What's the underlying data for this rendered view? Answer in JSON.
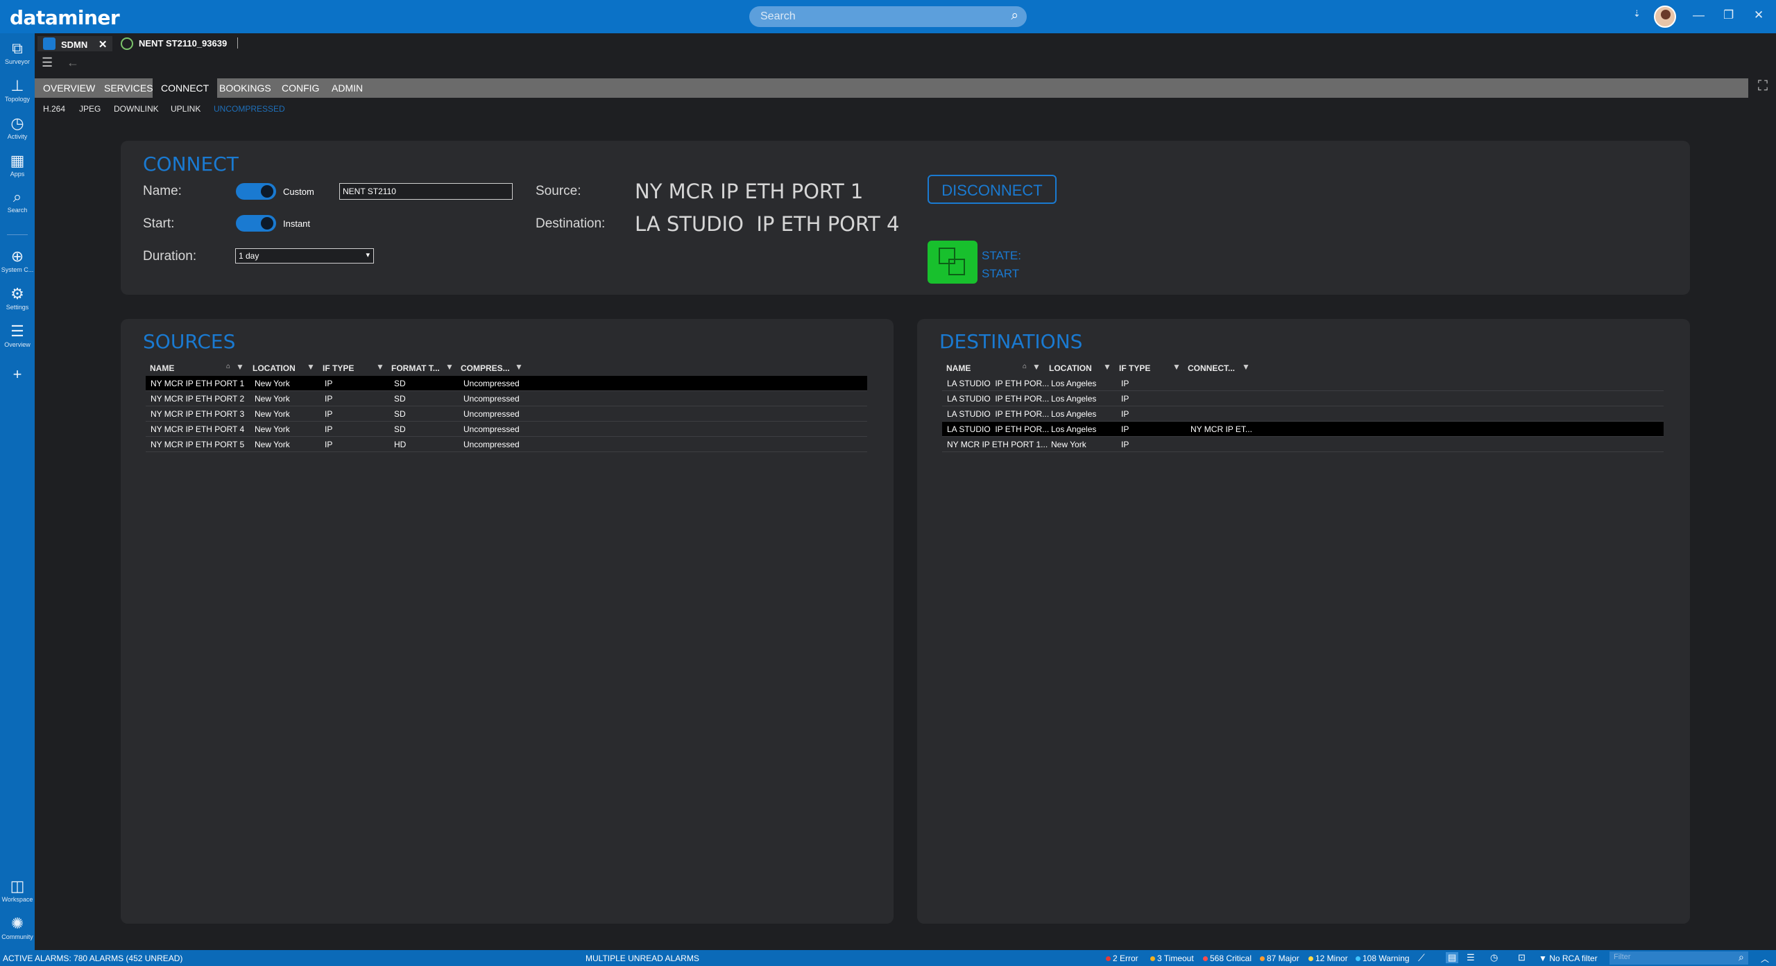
{
  "app": {
    "logo": "dataminer",
    "search_placeholder": "Search"
  },
  "colors": {
    "accent": "#1a7ad1",
    "topbar": "#0b72c7",
    "state_ok": "#18c02d"
  },
  "window": {
    "minimize": "—",
    "restore": "❐",
    "close": "✕"
  },
  "sidebar": {
    "top": [
      {
        "label": "Surveyor",
        "icon": "surveyor-icon"
      },
      {
        "label": "Topology",
        "icon": "topology-icon"
      },
      {
        "label": "Activity",
        "icon": "activity-icon"
      },
      {
        "label": "Apps",
        "icon": "apps-icon"
      },
      {
        "label": "Search",
        "icon": "search-icon"
      },
      {
        "label": "System C...",
        "icon": "globe-icon"
      },
      {
        "label": "Settings",
        "icon": "gear-icon"
      },
      {
        "label": "Overview",
        "icon": "list-icon"
      }
    ],
    "bottom": [
      {
        "label": "Workspace",
        "icon": "workspace-icon"
      },
      {
        "label": "Community",
        "icon": "community-icon"
      }
    ]
  },
  "tabs": [
    {
      "label": "SDMN",
      "closable": true
    },
    {
      "label": "NENT ST2110_93639",
      "closable": false
    }
  ],
  "menu": [
    "OVERVIEW",
    "SERVICES",
    "CONNECT",
    "BOOKINGS",
    "CONFIG",
    "ADMIN"
  ],
  "menu_active": "CONNECT",
  "submenu": [
    "H.264",
    "JPEG",
    "DOWNLINK",
    "UPLINK",
    "UNCOMPRESSED"
  ],
  "submenu_active": "UNCOMPRESSED",
  "connect": {
    "title": "CONNECT",
    "name_label": "Name:",
    "name_toggle": "Custom",
    "name_value": "NENT ST2110",
    "start_label": "Start:",
    "start_toggle": "Instant",
    "duration_label": "Duration:",
    "duration_value": "1 day",
    "source_label": "Source:",
    "source_value": "NY MCR IP ETH PORT 1",
    "destination_label": "Destination:",
    "destination_value": "LA STUDIO  IP ETH PORT 4",
    "disconnect": "DISCONNECT",
    "state_label": "STATE:",
    "state_value": "START"
  },
  "sources": {
    "title": "SOURCES",
    "columns": [
      "NAME",
      "LOCATION",
      "IF TYPE",
      "FORMAT T...",
      "COMPRES..."
    ],
    "rows": [
      [
        "NY MCR IP ETH PORT 1",
        "New York",
        "IP",
        "SD",
        "Uncompressed"
      ],
      [
        "NY MCR IP ETH PORT 2",
        "New York",
        "IP",
        "SD",
        "Uncompressed"
      ],
      [
        "NY MCR IP ETH PORT 3",
        "New York",
        "IP",
        "SD",
        "Uncompressed"
      ],
      [
        "NY MCR IP ETH PORT 4",
        "New York",
        "IP",
        "SD",
        "Uncompressed"
      ],
      [
        "NY MCR IP ETH PORT 5",
        "New York",
        "IP",
        "HD",
        "Uncompressed"
      ]
    ]
  },
  "destinations": {
    "title": "DESTINATIONS",
    "columns": [
      "NAME",
      "LOCATION",
      "IF TYPE",
      "CONNECT..."
    ],
    "rows": [
      [
        "LA STUDIO  IP ETH POR...",
        "Los Angeles",
        "IP",
        ""
      ],
      [
        "LA STUDIO  IP ETH POR...",
        "Los Angeles",
        "IP",
        ""
      ],
      [
        "LA STUDIO  IP ETH POR...",
        "Los Angeles",
        "IP",
        ""
      ],
      [
        "LA STUDIO  IP ETH POR...",
        "Los Angeles",
        "IP",
        "NY MCR IP ET..."
      ],
      [
        "NY MCR IP ETH PORT 1...",
        "New York",
        "IP",
        ""
      ]
    ]
  },
  "statusbar": {
    "active_alarms": "ACTIVE ALARMS: 780 ALARMS (452 UNREAD)",
    "center": "MULTIPLE UNREAD ALARMS",
    "error": "2 Error",
    "timeout": "3 Timeout",
    "critical": "568 Critical",
    "major": "87 Major",
    "minor": "12 Minor",
    "warning": "108 Warning",
    "rca": "No RCA filter",
    "filter_placeholder": "Filter"
  }
}
